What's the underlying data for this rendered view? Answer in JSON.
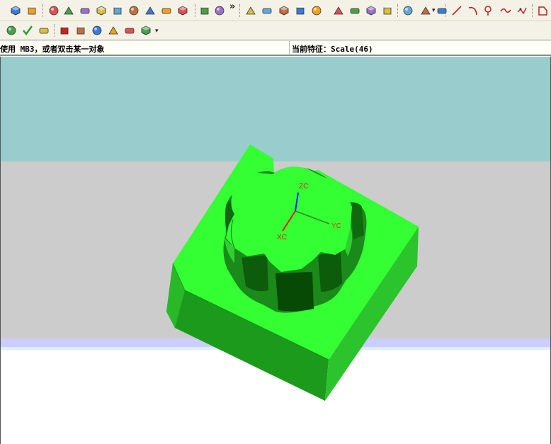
{
  "status": {
    "hint": "使用 MB3，或者双击某一对象",
    "current_feature": "当前特征：Scale(46)"
  },
  "axes": {
    "zc": "ZC",
    "yc": "YC",
    "xc": "XC"
  },
  "toolbar_row1": {
    "overflow_glyph": "»",
    "dropdown_glyph": "▾",
    "icons": [
      "box-view-icon",
      "sphere-view-icon",
      "cube-icon",
      "wedge-icon",
      "cone-icon",
      "cut-block-icon",
      "block-icon",
      "book-icon",
      "plate-icon",
      "cube-blue-icon",
      "cylinder-icon",
      "slab-icon",
      "eraser-icon",
      "sheet-icon",
      "surface-icon",
      "twisted-sheet-icon",
      "pattern-icon",
      "tag-icon",
      "shell-icon",
      "face-blue-icon",
      "cube-yellow-icon",
      "cube-orange-icon",
      "wrench-icon",
      "trim-icon",
      "face-orange-icon",
      "line-icon",
      "arc-icon",
      "spline-icon",
      "wave-icon",
      "point-icon",
      "tab-icon"
    ]
  },
  "toolbar_row2": {
    "dropdown_glyph": "▾",
    "icons": [
      "sketch-icon",
      "check-icon",
      "table-icon",
      "red-cube-icon",
      "bucket-icon",
      "cut-icon",
      "boolean-icon",
      "gear-icon",
      "tool-icon"
    ]
  },
  "colors": {
    "solid_top": "#33ff33",
    "solid_side_dark": "#1c9a1c",
    "solid_side_mid": "#2cc42c",
    "background_teal": "#99cccc",
    "background_gray": "#cccccc",
    "background_lavender": "#ccccff"
  }
}
